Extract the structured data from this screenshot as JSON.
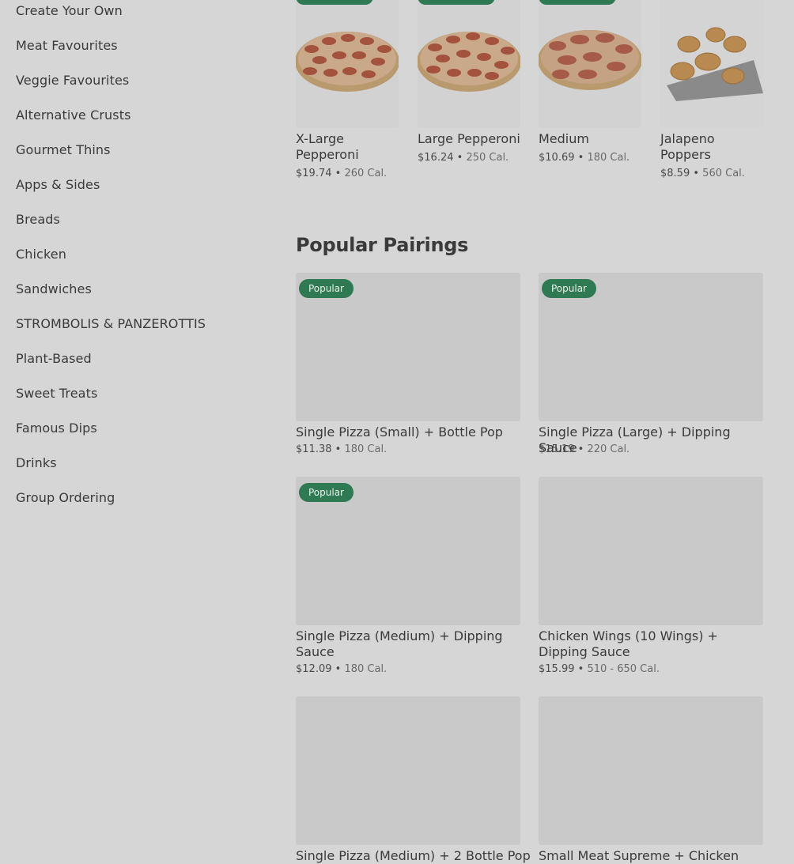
{
  "sidebar": {
    "items": [
      {
        "label": "Create Your Own"
      },
      {
        "label": "Meat Favourites"
      },
      {
        "label": "Veggie Favourites"
      },
      {
        "label": "Alternative Crusts"
      },
      {
        "label": "Gourmet Thins"
      },
      {
        "label": "Apps & Sides"
      },
      {
        "label": "Breads"
      },
      {
        "label": "Chicken"
      },
      {
        "label": "Sandwiches"
      },
      {
        "label": "STROMBOLIS & PANZEROTTIS"
      },
      {
        "label": "Plant-Based"
      },
      {
        "label": "Sweet Treats"
      },
      {
        "label": "Famous Dips"
      },
      {
        "label": "Drinks"
      },
      {
        "label": "Group Ordering"
      }
    ]
  },
  "top_items": [
    {
      "title": "X-Large Pepperoni",
      "price": "$19.74",
      "sep": "•",
      "cal": "260 Cal.",
      "icon": "pepperoni-pizza-image"
    },
    {
      "title": "Large Pepperoni",
      "price": "$16.24",
      "sep": "•",
      "cal": "250 Cal.",
      "icon": "pepperoni-pizza-image"
    },
    {
      "title": "Medium",
      "price": "$10.69",
      "sep": "•",
      "cal": "180 Cal.",
      "icon": "meat-pizza-image"
    },
    {
      "title": "Jalapeno Poppers",
      "price": "$8.59",
      "sep": "•",
      "cal": "560 Cal.",
      "icon": "jalapeno-poppers-image"
    }
  ],
  "pairings": {
    "title": "Popular Pairings",
    "items": [
      {
        "badge": "Popular",
        "title": "Single Pizza (Small) + Bottle Pop",
        "price": "$11.38",
        "sep": "•",
        "cal": "180 Cal."
      },
      {
        "badge": "Popular",
        "title": "Single Pizza (Large) + Dipping Sauce",
        "price": "$15.19",
        "sep": "•",
        "cal": "220 Cal."
      },
      {
        "badge": "Popular",
        "title": "Single Pizza (Medium) + Dipping Sauce",
        "price": "$12.09",
        "sep": "•",
        "cal": "180 Cal."
      },
      {
        "badge": "",
        "title": "Chicken Wings (10 Wings) + Dipping Sauce",
        "price": "$15.99",
        "sep": "•",
        "cal": "510 - 650 Cal."
      },
      {
        "badge": "",
        "title": "Single Pizza (Medium) + 2 Bottle Pop",
        "price": "",
        "sep": "",
        "cal": ""
      },
      {
        "badge": "",
        "title": "Small Meat Supreme + Chicken",
        "price": "",
        "sep": "",
        "cal": ""
      }
    ]
  },
  "colors": {
    "badge": "#2f7a52",
    "background": "#d6d6d6",
    "placeholder": "#c9c9c9"
  }
}
